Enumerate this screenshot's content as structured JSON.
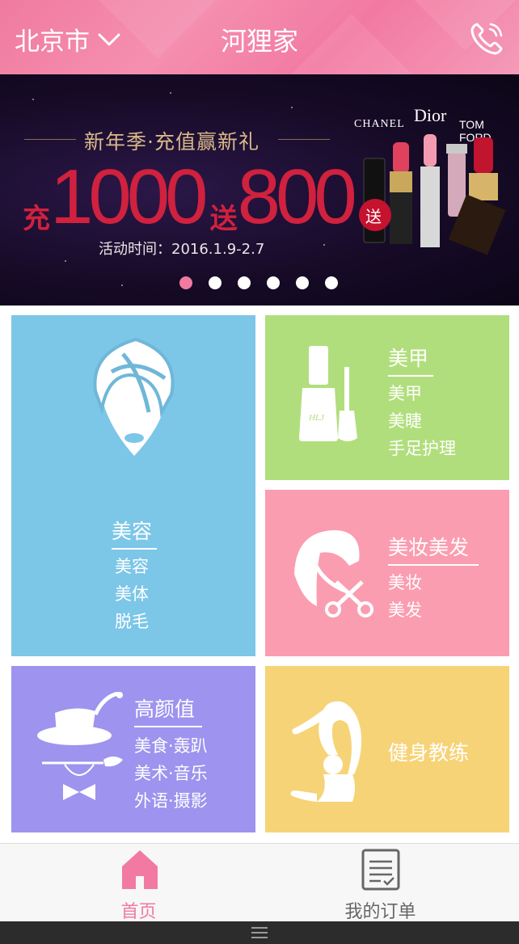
{
  "header": {
    "city": "北京市",
    "title": "河狸家",
    "city_dropdown_icon": "chevron-down-icon",
    "phone_icon": "phone-icon"
  },
  "banner": {
    "headline": "新年季·充值赢新礼",
    "promo_prefix": "充",
    "promo_amount": "1000",
    "promo_middle": "送",
    "promo_bonus": "800",
    "date": "活动时间：2016.1.9-2.7",
    "brands": [
      "CHANEL",
      "Dior",
      "TOM FORD"
    ],
    "gift_badge": "送",
    "carousel_total": 6,
    "carousel_active": 1
  },
  "categories": {
    "beauty": {
      "title": "美容",
      "items": [
        "美容",
        "美体",
        "脱毛"
      ],
      "color": "#7cc6e8"
    },
    "nail": {
      "title": "美甲",
      "items": [
        "美甲",
        "美睫",
        "手足护理"
      ],
      "color": "#b1de7c",
      "bottle_label": "HLJ"
    },
    "makeup": {
      "title": "美妆美发",
      "items": [
        "美妆",
        "美发"
      ],
      "color": "#fb9db0"
    },
    "value": {
      "title": "高颜值",
      "items": [
        "美食·轰趴",
        "美术·音乐",
        "外语·摄影"
      ],
      "color": "#9e93ee"
    },
    "fitness": {
      "title": "健身教练",
      "color": "#f7d377"
    }
  },
  "tabbar": {
    "home": {
      "label": "首页",
      "icon": "home-icon",
      "color": "#f27aa2"
    },
    "orders": {
      "label": "我的订单",
      "icon": "order-list-icon",
      "color": "#666666"
    }
  },
  "system": {
    "menu_icon": "menu-icon"
  }
}
